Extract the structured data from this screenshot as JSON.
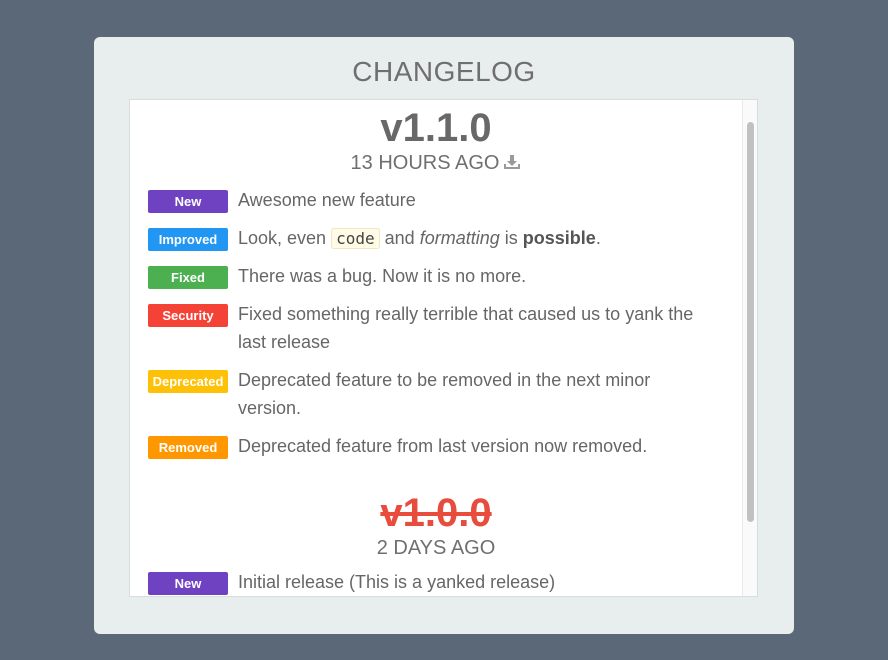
{
  "panel": {
    "title": "CHANGELOG"
  },
  "releases": [
    {
      "version": "v1.1.0",
      "age": "13 HOURS AGO",
      "download_icon": "download-icon",
      "items": [
        {
          "badge": "New",
          "badge_color": "#6f42c1",
          "text": "Awesome new feature"
        },
        {
          "badge": "Improved",
          "badge_color": "#2196f3",
          "text_parts": {
            "a": "Look, even",
            "code": "code",
            "b": "and",
            "em": "formatting",
            "c": "is",
            "strong": "possible",
            "d": "."
          }
        },
        {
          "badge": "Fixed",
          "badge_color": "#4caf50",
          "text": "There was a bug. Now it is no more."
        },
        {
          "badge": "Security",
          "badge_color": "#f44336",
          "text": "Fixed something really terrible that caused us to yank the last release"
        },
        {
          "badge": "Deprecated",
          "badge_color": "#ffc107",
          "text": "Deprecated feature to be removed in the next minor version."
        },
        {
          "badge": "Removed",
          "badge_color": "#ff9800",
          "text": "Deprecated feature from last version now removed."
        }
      ]
    },
    {
      "version": "v1.0.0",
      "yanked": true,
      "age": "2 DAYS AGO",
      "items": [
        {
          "badge": "New",
          "badge_color": "#6f42c1",
          "text": "Initial release (This is a yanked release)"
        }
      ]
    }
  ]
}
